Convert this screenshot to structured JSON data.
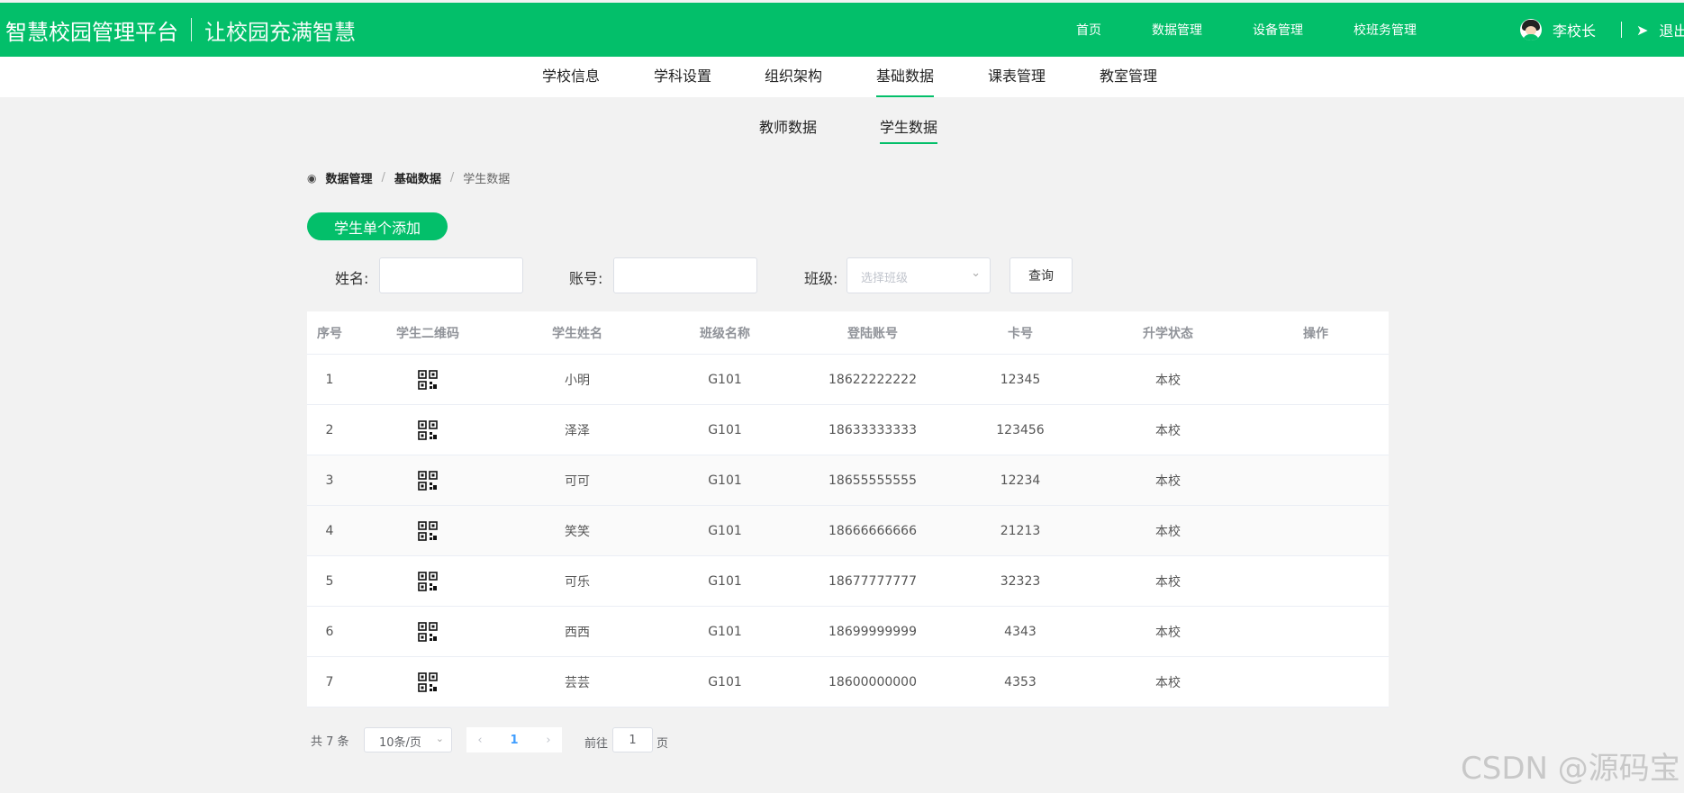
{
  "header": {
    "brand_title": "智慧校园管理平台",
    "brand_slogan": "让校园充满智慧",
    "nav": [
      "首页",
      "数据管理",
      "设备管理",
      "校班务管理"
    ],
    "user_name": "李校长",
    "logout": "退出"
  },
  "subnav": {
    "tabs": [
      "学校信息",
      "学科设置",
      "组织架构",
      "基础数据",
      "课表管理",
      "教室管理"
    ],
    "active": "基础数据"
  },
  "data_tabs": {
    "tabs": [
      "教师数据",
      "学生数据"
    ],
    "active": "学生数据"
  },
  "breadcrumb": [
    "数据管理",
    "基础数据",
    "学生数据"
  ],
  "add_button": "学生单个添加",
  "filters": {
    "name_label": "姓名:",
    "name_value": "",
    "account_label": "账号:",
    "account_value": "",
    "class_label": "班级:",
    "class_placeholder": "选择班级",
    "query_button": "查询"
  },
  "table": {
    "columns": [
      "序号",
      "学生二维码",
      "学生姓名",
      "班级名称",
      "登陆账号",
      "卡号",
      "升学状态",
      "操作"
    ],
    "rows": [
      {
        "no": "1",
        "name": "小明",
        "class": "G101",
        "account": "18622222222",
        "card": "12345",
        "status": "本校",
        "action": ""
      },
      {
        "no": "2",
        "name": "泽泽",
        "class": "G101",
        "account": "18633333333",
        "card": "123456",
        "status": "本校",
        "action": ""
      },
      {
        "no": "3",
        "name": "可可",
        "class": "G101",
        "account": "18655555555",
        "card": "12234",
        "status": "本校",
        "action": ""
      },
      {
        "no": "4",
        "name": "笑笑",
        "class": "G101",
        "account": "18666666666",
        "card": "21213",
        "status": "本校",
        "action": ""
      },
      {
        "no": "5",
        "name": "可乐",
        "class": "G101",
        "account": "18677777777",
        "card": "32323",
        "status": "本校",
        "action": ""
      },
      {
        "no": "6",
        "name": "西西",
        "class": "G101",
        "account": "18699999999",
        "card": "4343",
        "status": "本校",
        "action": ""
      },
      {
        "no": "7",
        "name": "芸芸",
        "class": "G101",
        "account": "18600000000",
        "card": "4353",
        "status": "本校",
        "action": ""
      }
    ]
  },
  "pagination": {
    "total_text": "共 7 条",
    "page_size": "10条/页",
    "current_page": "1",
    "goto_label": "前往",
    "goto_value": "1",
    "goto_suffix": "页"
  },
  "watermark": "CSDN @源码宝",
  "colors": {
    "brand": "#03bf6a",
    "link": "#409eff"
  },
  "icons": {
    "breadcrumb": "location-pin-icon",
    "qr": "qr-code-icon",
    "send": "send-icon"
  }
}
